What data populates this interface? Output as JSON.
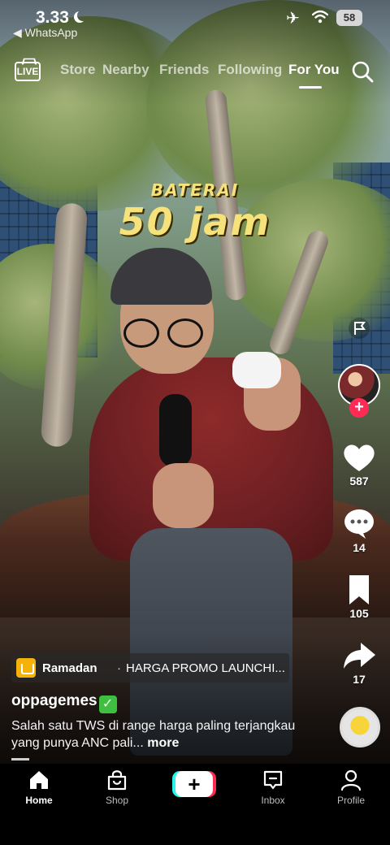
{
  "status_bar": {
    "time": "3.33",
    "back_app": "◀ WhatsApp",
    "battery": "58"
  },
  "top_tabs": {
    "live_label": "LIVE",
    "items": [
      "Store",
      "Nearby",
      "Friends",
      "Following",
      "For You"
    ],
    "active": "For You"
  },
  "video_overlay": {
    "line1": "BATERAI",
    "line2": "50 jam"
  },
  "right_rail": {
    "likes": "587",
    "comments": "14",
    "saves": "105",
    "shares": "17",
    "follow_symbol": "+"
  },
  "caption": {
    "promo_tag": "Ramadan",
    "promo_separator": "·",
    "promo_text": "HARGA PROMO LAUNCHI...",
    "username": "oppagemes",
    "verified_mark": "✓",
    "description": "Salah satu TWS di range harga paling terjangkau yang punya ANC pali...",
    "more_label": "more"
  },
  "bottom_nav": {
    "items": [
      {
        "label": "Home",
        "icon": "home-icon"
      },
      {
        "label": "Shop",
        "icon": "shop-bag-icon"
      },
      {
        "label": "",
        "icon": "create-plus-icon"
      },
      {
        "label": "Inbox",
        "icon": "inbox-icon"
      },
      {
        "label": "Profile",
        "icon": "profile-icon"
      }
    ],
    "create_symbol": "+",
    "active": "Home"
  },
  "colors": {
    "accent_red": "#fe2c55",
    "accent_cyan": "#25f4ee",
    "overlay_yellow": "#f6e27a",
    "promo_icon": "#f5b20b"
  }
}
